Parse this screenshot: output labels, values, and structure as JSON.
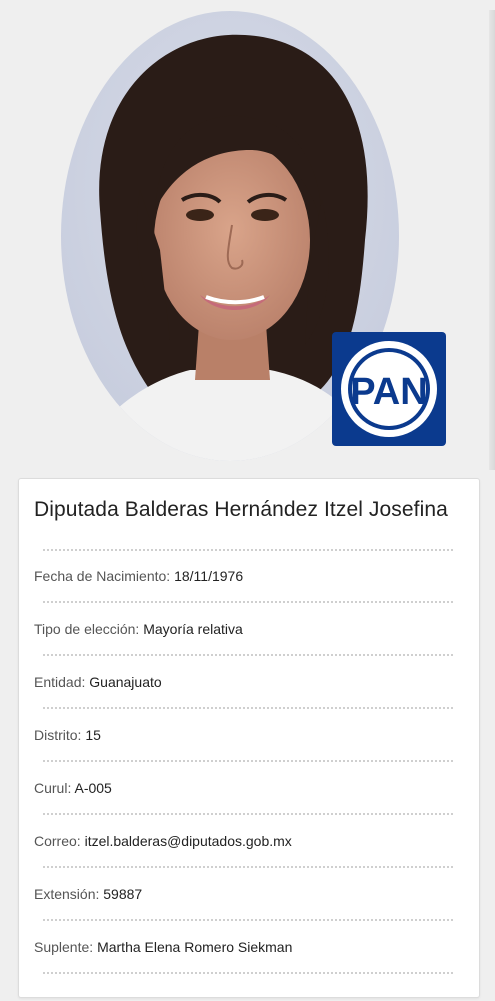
{
  "profile": {
    "title": "Diputada Balderas Hernández Itzel Josefina",
    "party_logo_text": "PAN",
    "party_color": "#0b3a8e",
    "fields": [
      {
        "label": "Fecha de Nacimiento:",
        "value": "18/11/1976"
      },
      {
        "label": "Tipo de elección:",
        "value": "Mayoría relativa"
      },
      {
        "label": "Entidad:",
        "value": "Guanajuato"
      },
      {
        "label": "Distrito:",
        "value": "15"
      },
      {
        "label": "Curul:",
        "value": "A-005"
      },
      {
        "label": "Correo:",
        "value": "itzel.balderas@diputados.gob.mx"
      },
      {
        "label": "Extensión:",
        "value": "59887"
      },
      {
        "label": "Suplente:",
        "value": "Martha Elena Romero Siekman"
      }
    ]
  }
}
